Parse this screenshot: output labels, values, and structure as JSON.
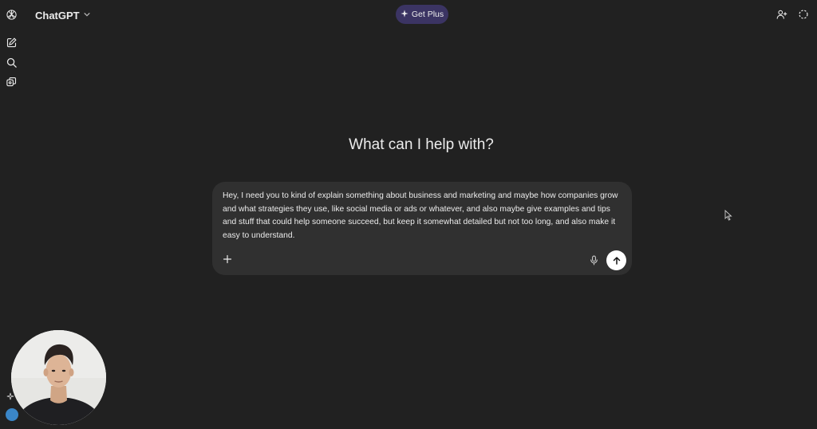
{
  "app": {
    "model_name": "ChatGPT",
    "upgrade_label": "Get Plus"
  },
  "icons": {
    "logo": "openai-logo-icon",
    "new_chat": "edit-icon",
    "search": "search-icon",
    "library": "library-icon",
    "share_person": "add-person-icon",
    "temporary_chat": "dashed-circle-icon",
    "attach": "plus-icon",
    "dictate": "mic-icon",
    "send": "arrow-up-icon",
    "sparkle": "sparkle-icon"
  },
  "main": {
    "headline": "What can I help with?"
  },
  "composer": {
    "prompt_text": "Hey, I need you to kind of explain something about business and marketing and maybe how companies grow and what strategies they use, like social media or ads or whatever, and also maybe give examples and tips and stuff that could help someone succeed, but keep it somewhat detailed but not too long, and also make it easy to understand."
  },
  "colors": {
    "background": "#212121",
    "composer_bg": "#303030",
    "get_plus_bg": "#3b3463",
    "text": "#ececec",
    "send_bg": "#ffffff"
  }
}
